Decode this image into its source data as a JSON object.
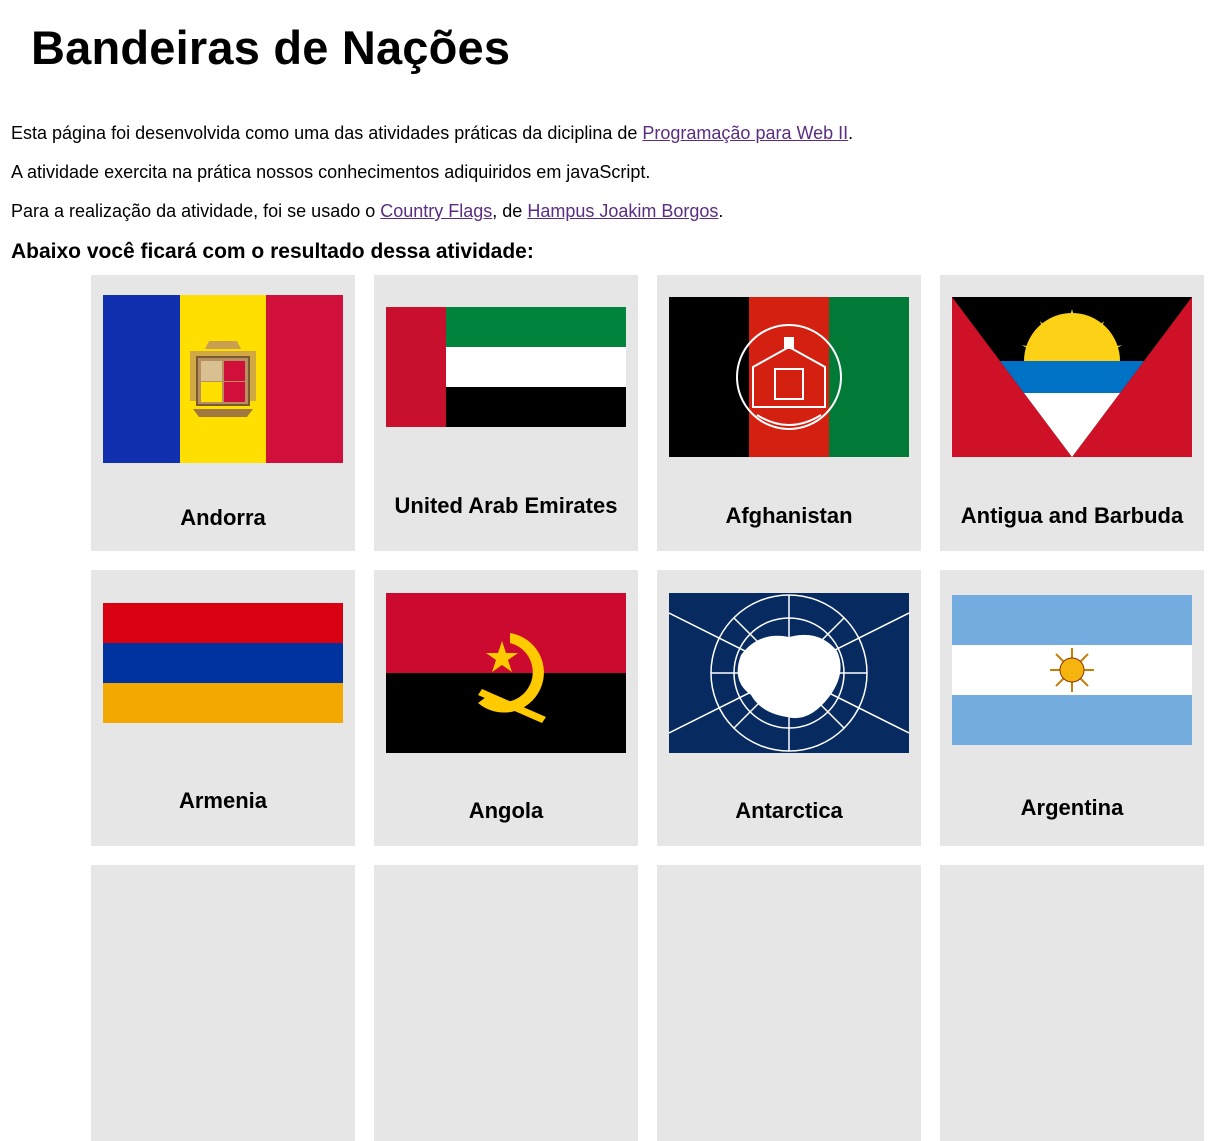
{
  "page": {
    "title": "Bandeiras de Nações",
    "intro1_prefix": "Esta página foi desenvolvida como uma das atividades práticas da diciplina de ",
    "intro1_link": "Programação para Web II",
    "intro1_suffix": ".",
    "intro2": "A atividade exercita na prática nossos conhecimentos adiquiridos em javaScript.",
    "intro3_prefix": "Para a realização da atividade, foi se usado o ",
    "intro3_link1": "Country Flags",
    "intro3_middle": ", de ",
    "intro3_link2": "Hampus Joakim Borgos",
    "intro3_suffix": ".",
    "subtitle": "Abaixo você ficará com o resultado dessa atividade:"
  },
  "countries": [
    {
      "name": "Andorra",
      "flag_icon": "andorra-flag"
    },
    {
      "name": "United Arab Emirates",
      "flag_icon": "uae-flag"
    },
    {
      "name": "Afghanistan",
      "flag_icon": "afghanistan-flag"
    },
    {
      "name": "Antigua and Barbuda",
      "flag_icon": "antigua-flag"
    },
    {
      "name": "Armenia",
      "flag_icon": "armenia-flag"
    },
    {
      "name": "Angola",
      "flag_icon": "angola-flag"
    },
    {
      "name": "Antarctica",
      "flag_icon": "antarctica-flag"
    },
    {
      "name": "Argentina",
      "flag_icon": "argentina-flag"
    }
  ]
}
